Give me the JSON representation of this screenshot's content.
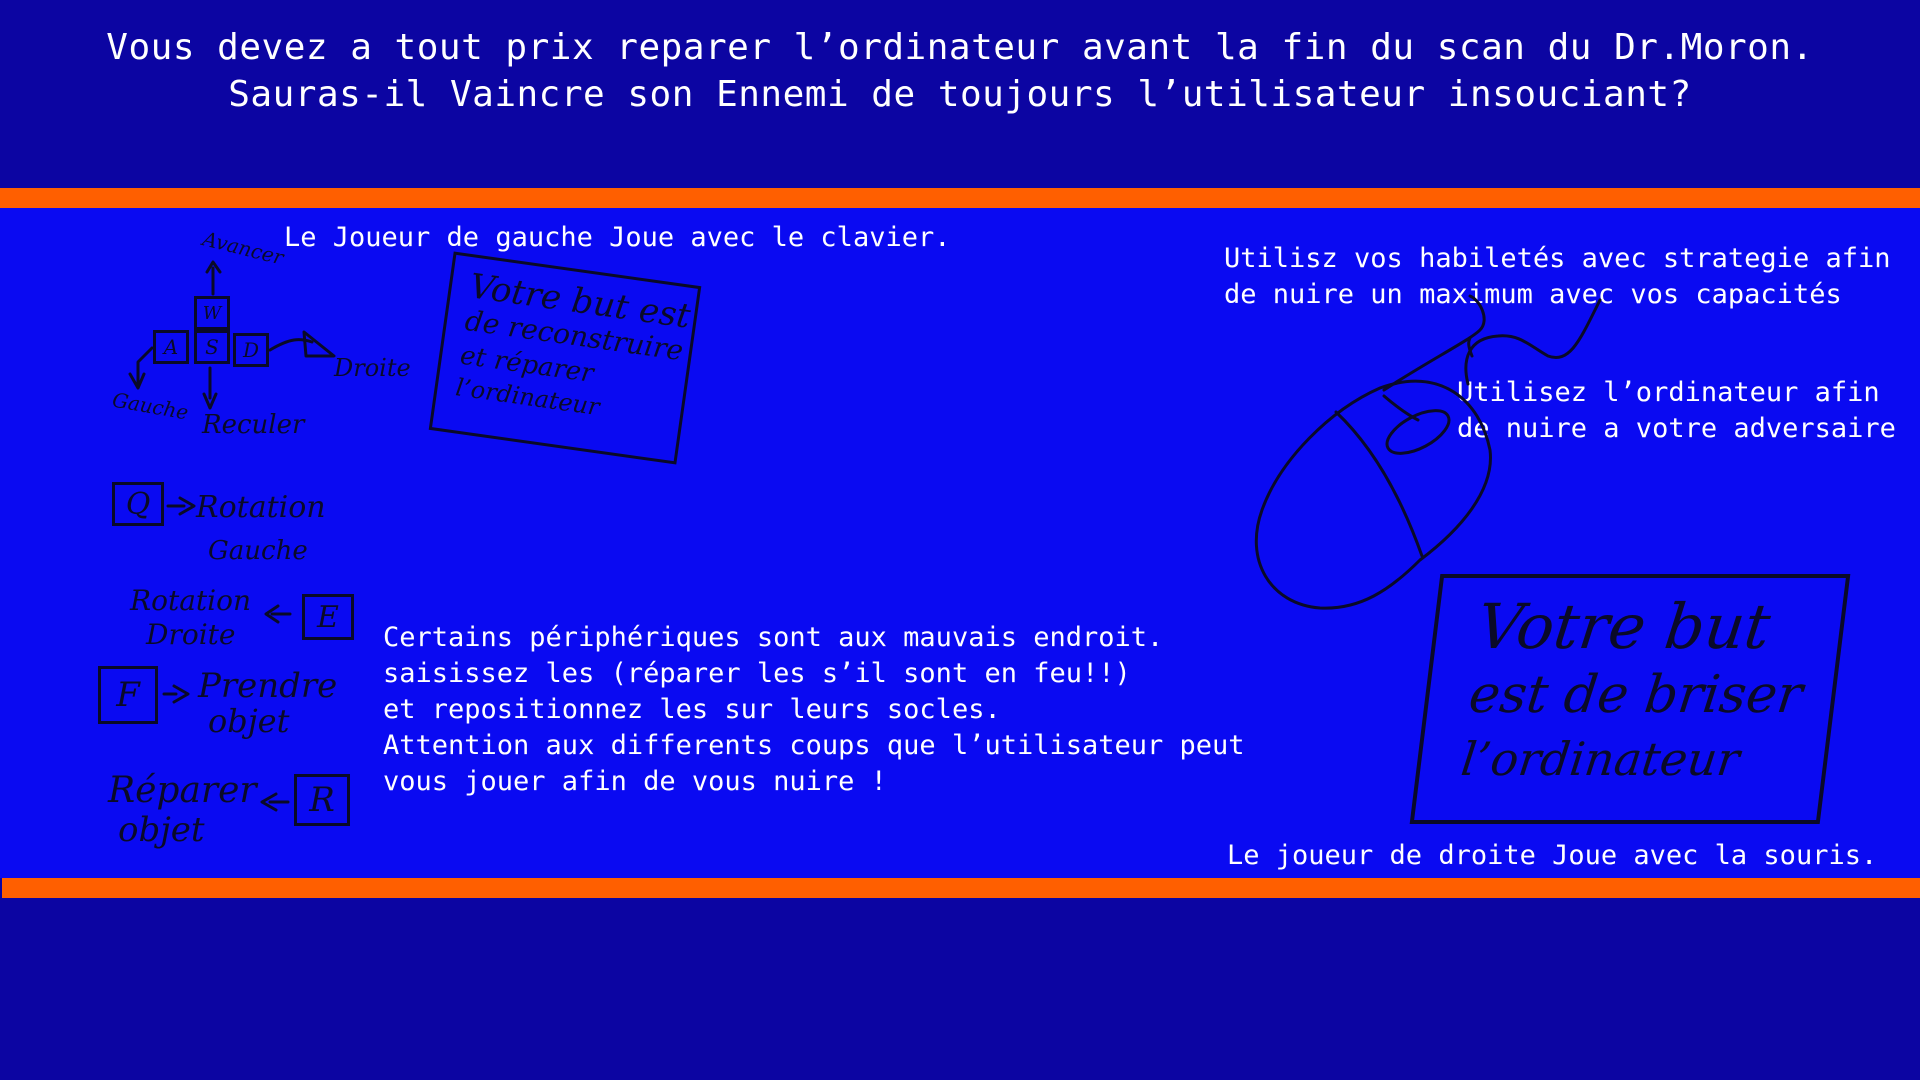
{
  "intro": {
    "line1": "Vous devez a tout prix reparer l’ordinateur avant la fin du scan du Dr.Moron.",
    "line2": "Sauras-il Vaincre son Ennemi de toujours l’utilisateur insouciant?"
  },
  "left_player": {
    "title": "Le Joueur de gauche Joue avec le clavier.",
    "keys": {
      "w": "W",
      "a": "A",
      "s": "S",
      "d": "D",
      "q": "Q",
      "e": "E",
      "f": "F",
      "r": "R"
    },
    "labels": {
      "avancer": "Avancer",
      "droite": "Droite",
      "gauche": "Gauche",
      "reculer": "Reculer",
      "q_action_1": "Rotation",
      "q_action_2": "Gauche",
      "e_action_1": "Rotation",
      "e_action_2": "Droite",
      "f_action_1": "Prendre",
      "f_action_2": "objet",
      "r_action_1": "Réparer",
      "r_action_2": "objet"
    },
    "goal_note": {
      "line1": "Votre but est",
      "line2": "de reconstruire",
      "line3": "et réparer",
      "line4": "l’ordinateur"
    },
    "instructions": [
      "Certains périphériques sont aux mauvais endroit.",
      "saisissez les (réparer les s’il sont en feu!!)",
      "et repositionnez les sur leurs socles.",
      "Attention aux differents coups que l’utilisateur peut",
      "vous jouer afin de vous nuire !"
    ]
  },
  "right_player": {
    "abilities_text": [
      "Utilisz vos habiletés avec strategie afin",
      "de nuire un maximum avec vos capacités"
    ],
    "computer_text": [
      "Utilisez l’ordinateur afin",
      "de nuire a votre adversaire"
    ],
    "goal_note": {
      "line1": "Votre but",
      "line2": "est de briser",
      "line3": "l’ordinateur"
    },
    "title": "Le joueur de droite Joue avec la souris.",
    "mouse_icon": "mouse-icon"
  },
  "colors": {
    "background": "#0c05a2",
    "panel": "#0a0af2",
    "accent": "#ff5f00",
    "text": "#ffffff",
    "ink": "#0a0a28"
  }
}
